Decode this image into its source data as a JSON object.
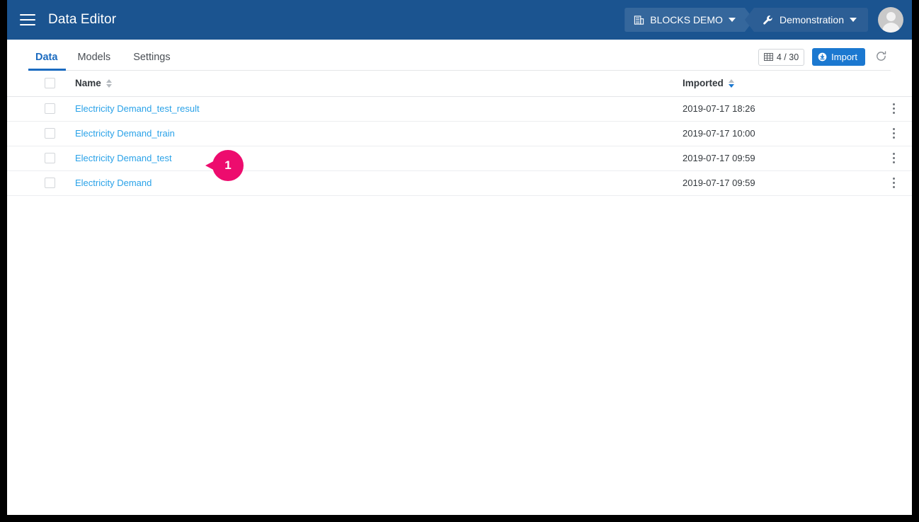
{
  "window": {
    "frame_color": "#000000",
    "background": "#ffffff"
  },
  "header": {
    "background": "#1b5490",
    "menu_icon": "hamburger-menu-icon",
    "title": "Data Editor",
    "breadcrumbs": [
      {
        "icon": "building-icon",
        "label": "BLOCKS DEMO",
        "caret": "chevron-down-icon"
      },
      {
        "icon": "wrench-icon",
        "label": "Demonstration",
        "caret": "chevron-down-icon"
      }
    ],
    "avatar": "user-avatar-icon"
  },
  "tabs": [
    {
      "label": "Data",
      "active": true
    },
    {
      "label": "Models",
      "active": false
    },
    {
      "label": "Settings",
      "active": false
    }
  ],
  "toolbar": {
    "counter_icon": "table-grid-icon",
    "counter_label": "4 / 30",
    "import_icon": "import-circle-icon",
    "import_label": "Import",
    "refresh_icon": "refresh-icon",
    "accent_color": "#1b78d0"
  },
  "table": {
    "columns": {
      "select_all": "",
      "name": "Name",
      "imported": "Imported"
    },
    "sort": {
      "name": "none",
      "imported": "desc"
    },
    "rows": [
      {
        "name": "Electricity Demand_test_result",
        "imported": "2019-07-17 18:26",
        "checked": false
      },
      {
        "name": "Electricity Demand_train",
        "imported": "2019-07-17 10:00",
        "checked": false
      },
      {
        "name": "Electricity Demand_test",
        "imported": "2019-07-17 09:59",
        "checked": false
      },
      {
        "name": "Electricity Demand",
        "imported": "2019-07-17 09:59",
        "checked": false
      }
    ],
    "link_color": "#2aa2e8",
    "row_menu_icon": "kebab-menu-icon"
  },
  "annotations": [
    {
      "number": "1",
      "color": "#ed0c6e",
      "target": "Electricity Demand_test_result"
    }
  ]
}
